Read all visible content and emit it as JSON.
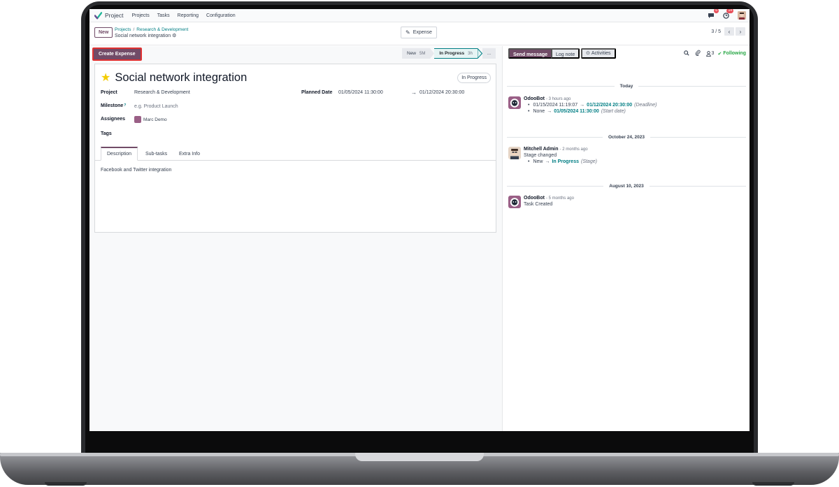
{
  "navbar": {
    "app_name": "Project",
    "menu": [
      "Projects",
      "Tasks",
      "Reporting",
      "Configuration"
    ],
    "chat_badge": "6",
    "activity_badge": "14",
    "icons": [
      "chat-icon",
      "clock-icon"
    ]
  },
  "control": {
    "new_label": "New",
    "breadcrumb": [
      "Projects",
      "Research & Development"
    ],
    "record_name": "Social network integration",
    "expense_label": "Expense",
    "pager": "3 / 5"
  },
  "form": {
    "create_expense_label": "Create Expense",
    "stages": [
      {
        "label": "New",
        "meta": "5M",
        "active": false
      },
      {
        "label": "In Progress",
        "meta": "3h",
        "active": true
      },
      {
        "label": "...",
        "meta": "",
        "active": false
      }
    ],
    "state": "In Progress",
    "title": "Social network integration",
    "fields": {
      "project_label": "Project",
      "project_value": "Research & Development",
      "milestone_label": "Milestone",
      "milestone_help": "?",
      "milestone_placeholder": "e.g. Product Launch",
      "assignees_label": "Assignees",
      "assignee_value": "Marc Demo",
      "tags_label": "Tags",
      "planned_date_label": "Planned Date",
      "planned_start": "01/05/2024 11:30:00",
      "planned_end": "01/12/2024 20:30:00"
    },
    "tabs": [
      "Description",
      "Sub-tasks",
      "Extra Info"
    ],
    "description": "Facebook and Twitter integration"
  },
  "chatter": {
    "send_message": "Send message",
    "log_note": "Log note",
    "activities": "Activities",
    "followers_count": "3",
    "following": "Following",
    "separators": [
      "Today",
      "October 24, 2023",
      "August 10, 2023"
    ],
    "messages": [
      {
        "author": "OdooBot",
        "time": "- 3 hours ago",
        "tracks": [
          {
            "old": "01/15/2024 11:19:07",
            "new": "01/12/2024 20:30:00",
            "field": "(Deadline)"
          },
          {
            "old": "None",
            "new": "01/05/2024 11:30:00",
            "field": "(Start date)"
          }
        ]
      },
      {
        "author": "Mitchell Admin",
        "time": "- 2 months ago",
        "text": "Stage changed",
        "tracks": [
          {
            "old": "New",
            "new": "In Progress",
            "field": "(Stage)"
          }
        ]
      },
      {
        "author": "OdooBot",
        "time": "- 5 months ago",
        "text": "Task Created"
      }
    ]
  },
  "colors": {
    "brand": "#714b67",
    "accent": "#017e84",
    "highlight_border": "#e03131",
    "star": "#f3cc00",
    "following": "#28a745"
  }
}
